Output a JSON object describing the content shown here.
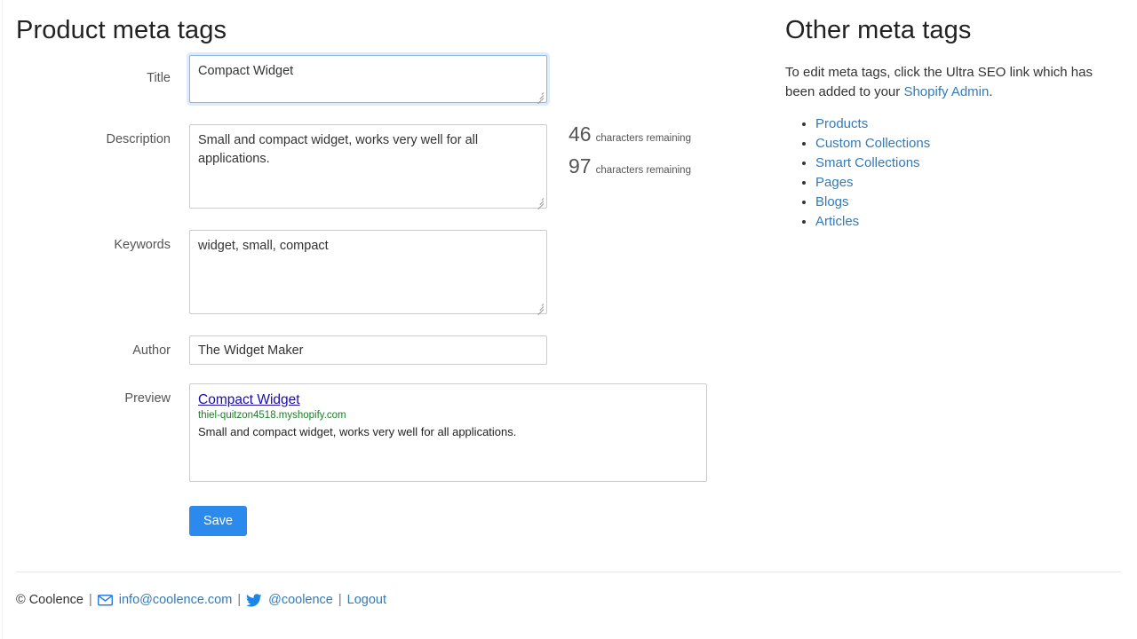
{
  "left": {
    "heading": "Product meta tags",
    "fields": {
      "title": {
        "label": "Title",
        "value": "Compact Widget",
        "counter_number": "46",
        "counter_label": "characters remaining"
      },
      "description": {
        "label": "Description",
        "value": "Small and compact widget, works very well for all applications.",
        "counter_number": "97",
        "counter_label": "characters remaining"
      },
      "keywords": {
        "label": "Keywords",
        "value": "widget, small, compact"
      },
      "author": {
        "label": "Author",
        "value": "The Widget Maker"
      },
      "preview": {
        "label": "Preview",
        "serp_title": "Compact Widget",
        "serp_url": "thiel-quitzon4518.myshopify.com",
        "serp_snippet": "Small and compact widget, works very well for all applications."
      }
    },
    "save_label": "Save"
  },
  "right": {
    "heading": "Other meta tags",
    "note_before": "To edit meta tags, click the Ultra SEO link which has been added to your ",
    "note_link": "Shopify Admin",
    "note_after": ".",
    "links": [
      "Products",
      "Custom Collections",
      "Smart Collections",
      "Pages",
      "Blogs",
      "Articles"
    ]
  },
  "footer": {
    "copyright": "© Coolence",
    "sep1": "|",
    "email": "info@coolence.com",
    "sep2": "|",
    "twitter": "@coolence",
    "sep3": "|",
    "logout": "Logout"
  },
  "colors": {
    "link": "#337ab7",
    "save_button": "#2b8aeb",
    "serp_title": "#1a0dab",
    "serp_url": "#1a7f28",
    "focus_border": "#8cb8e8"
  }
}
